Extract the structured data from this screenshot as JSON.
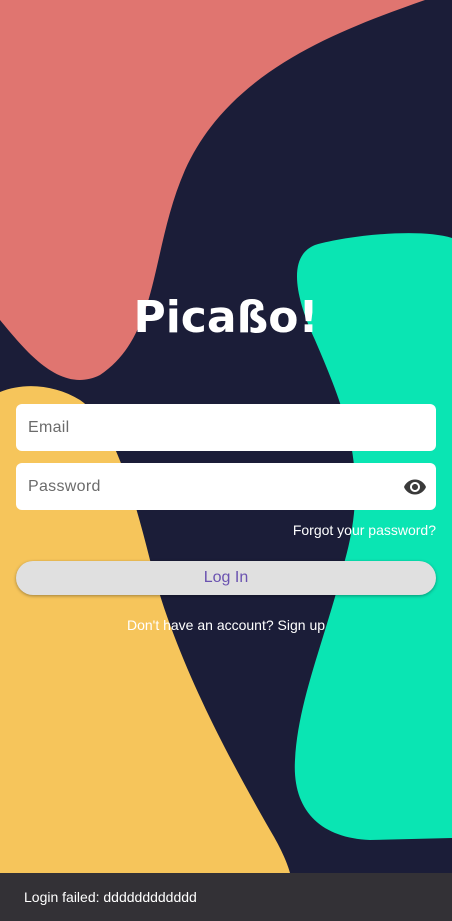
{
  "app": {
    "title": "Picaßo!"
  },
  "form": {
    "email_placeholder": "Email",
    "email_value": "",
    "password_placeholder": "Password",
    "password_value": "",
    "password_toggle_icon": "eye-icon",
    "forgot_label": "Forgot your password?",
    "login_label": "Log In",
    "signup_prompt": "Don't have an account?",
    "signup_link": "Sign up"
  },
  "snackbar": {
    "message": "Login failed: dddddddddddd"
  },
  "colors": {
    "background": "#1b1d38",
    "blob_coral": "#e07570",
    "blob_mint": "#0ae5b3",
    "blob_yellow": "#f6c55b",
    "button_text": "#6a52b0",
    "button_bg": "#e0e0e0",
    "snackbar_bg": "#333136"
  }
}
